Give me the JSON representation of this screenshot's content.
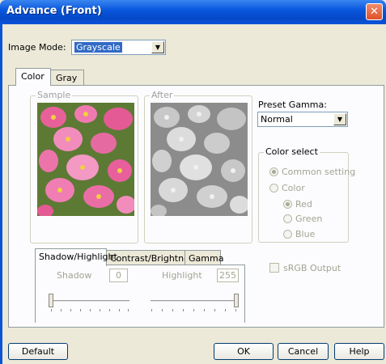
{
  "window": {
    "title": "Advance (Front)",
    "close_label": "✕"
  },
  "image_mode": {
    "label": "Image Mode:",
    "value": "Grayscale"
  },
  "tabs": [
    {
      "label": "Color"
    },
    {
      "label": "Gray"
    }
  ],
  "sample": {
    "label": "Sample"
  },
  "after": {
    "label": "After"
  },
  "preset_gamma": {
    "label": "Preset Gamma:",
    "value": "Normal"
  },
  "color_select": {
    "label": "Color select",
    "options": [
      "Common setting",
      "Color",
      "Red",
      "Green",
      "Blue"
    ]
  },
  "sub_tabs": [
    {
      "label": "Shadow/Highlight"
    },
    {
      "label": "Contrast/Brightness"
    },
    {
      "label": "Gamma"
    }
  ],
  "shadow": {
    "label": "Shadow",
    "value": "0"
  },
  "highlight": {
    "label": "Highlight",
    "value": "255"
  },
  "srgb": {
    "label": "sRGB Output"
  },
  "buttons": {
    "default": "Default",
    "ok": "OK",
    "cancel": "Cancel",
    "help": "Help"
  },
  "colors": {
    "title_blue": "#0a58de",
    "close_red": "#e0502a",
    "panel": "#fcfcfe",
    "dialog_bg": "#ece9d8"
  }
}
